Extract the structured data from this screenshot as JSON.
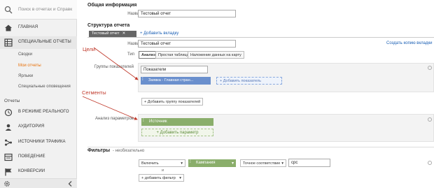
{
  "sidebar": {
    "search_placeholder": "Поиск в отчетах и Справк",
    "home": "ГЛАВНАЯ",
    "special_reports": "СПЕЦИАЛЬНЫЕ ОТЧЕТЫ",
    "sub_items": [
      "Сводки",
      "Мои отчеты",
      "Ярлыки",
      "Специальные оповещения"
    ],
    "reports_section": "Отчеты",
    "realtime": "В РЕЖИМЕ РЕАЛЬНОГО",
    "audience": "АУДИТОРИЯ",
    "traffic": "ИСТОЧНИКИ ТРАФИКА",
    "behavior": "ПОВЕДЕНИЕ",
    "conversions": "КОНВЕРСИИ"
  },
  "general": {
    "heading": "Общая информация",
    "name_label": "Название",
    "name_value": "Тестовый отчет"
  },
  "structure": {
    "heading": "Структура отчета",
    "tab_label": "Тестовый отчет",
    "add_tab": "+ Добавить вкладку",
    "name_label": "Название",
    "name_value": "Тестовый отчет",
    "copy_tab_link": "Создать копию вкладки",
    "type_label": "Тип",
    "types": [
      "Анализ",
      "Простая таблица",
      "Наложение данных на карту"
    ],
    "metric_groups_label": "Группы показателей",
    "metric_group_name": "Показатели",
    "metric_pill": "Заявка - Главная стран...",
    "add_metric": "+ Добавить показатель",
    "add_metric_group": "+ Добавить группу показателей",
    "dimensions_label": "Анализ параметров",
    "dimension_pill": "Источник",
    "add_dimension": "+ Добавить параметр"
  },
  "filters": {
    "heading": "Фильтры",
    "subheading": "- необязательно",
    "include": "Включить",
    "dimension": "Кампания",
    "match": "Точное соответствие",
    "value": "cpc",
    "and_label": "и",
    "add_filter": "+ добавить фильтр"
  },
  "annotations": {
    "goals": "Цели",
    "segments": "Сегменты"
  },
  "colors": {
    "metric_pill": "#6a8fcd",
    "dimension_pill": "#8aae6b",
    "annotation": "#c0392b",
    "link": "#1a5fb4"
  }
}
